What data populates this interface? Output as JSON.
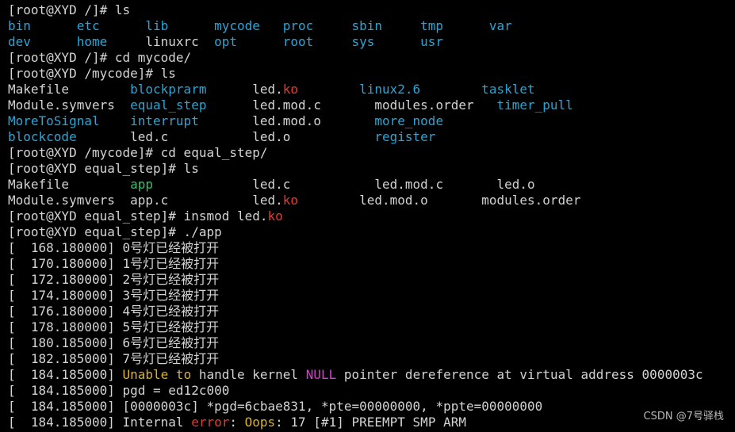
{
  "terminal": {
    "colors": {
      "background": "#000000",
      "text": "#d4d4d4",
      "blue": "#2aa5d5",
      "red": "#e33b2e",
      "green": "#2ec66a",
      "yellow": "#d9b230",
      "magenta": "#e13ad6"
    },
    "lines": [
      [
        {
          "t": "[root@XYD /]# ls",
          "c": "white"
        }
      ],
      [
        {
          "t": "bin",
          "c": "blue",
          "w": 9
        },
        {
          "t": "etc",
          "c": "blue",
          "w": 9
        },
        {
          "t": "lib",
          "c": "blue",
          "w": 9
        },
        {
          "t": "mycode",
          "c": "blue",
          "w": 9
        },
        {
          "t": "proc",
          "c": "blue",
          "w": 9
        },
        {
          "t": "sbin",
          "c": "blue",
          "w": 9
        },
        {
          "t": "tmp",
          "c": "blue",
          "w": 9
        },
        {
          "t": "var",
          "c": "blue"
        }
      ],
      [
        {
          "t": "dev",
          "c": "blue",
          "w": 9
        },
        {
          "t": "home",
          "c": "blue",
          "w": 9
        },
        {
          "t": "linuxrc",
          "c": "white",
          "w": 9
        },
        {
          "t": "opt",
          "c": "blue",
          "w": 9
        },
        {
          "t": "root",
          "c": "blue",
          "w": 9
        },
        {
          "t": "sys",
          "c": "blue",
          "w": 9
        },
        {
          "t": "usr",
          "c": "blue"
        }
      ],
      [
        {
          "t": "[root@XYD /]# cd mycode/",
          "c": "white"
        }
      ],
      [
        {
          "t": "[root@XYD /mycode]# ls",
          "c": "white"
        }
      ],
      [
        {
          "t": "Makefile",
          "c": "white",
          "w": 16
        },
        {
          "t": "blockprarm",
          "c": "blue",
          "w": 16
        },
        {
          "t": "led.",
          "c": "white"
        },
        {
          "t": "ko",
          "c": "red",
          "w": 10
        },
        {
          "t": "linux2.6",
          "c": "blue",
          "w": 16
        },
        {
          "t": "tasklet",
          "c": "blue"
        }
      ],
      [
        {
          "t": "Module.symvers",
          "c": "white",
          "w": 16
        },
        {
          "t": "equal_step",
          "c": "blue",
          "w": 16
        },
        {
          "t": "led.mod.c",
          "c": "white",
          "w": 16
        },
        {
          "t": "modules.order",
          "c": "white",
          "w": 16
        },
        {
          "t": "timer_pull",
          "c": "blue"
        }
      ],
      [
        {
          "t": "MoreToSignal",
          "c": "blue",
          "w": 16
        },
        {
          "t": "interrupt",
          "c": "blue",
          "w": 16
        },
        {
          "t": "led.mod.o",
          "c": "white",
          "w": 16
        },
        {
          "t": "more_node",
          "c": "blue"
        }
      ],
      [
        {
          "t": "blockcode",
          "c": "blue",
          "w": 16
        },
        {
          "t": "led.c",
          "c": "white",
          "w": 16
        },
        {
          "t": "led.o",
          "c": "white",
          "w": 16
        },
        {
          "t": "register",
          "c": "blue"
        }
      ],
      [
        {
          "t": "[root@XYD /mycode]# cd equal_step/",
          "c": "white"
        }
      ],
      [
        {
          "t": "[root@XYD equal_step]# ls",
          "c": "white"
        }
      ],
      [
        {
          "t": "Makefile",
          "c": "white",
          "w": 16
        },
        {
          "t": "app",
          "c": "green",
          "w": 16
        },
        {
          "t": "led.c",
          "c": "white",
          "w": 16
        },
        {
          "t": "led.mod.c",
          "c": "white",
          "w": 16
        },
        {
          "t": "led.o",
          "c": "white"
        }
      ],
      [
        {
          "t": "Module.symvers",
          "c": "white",
          "w": 16
        },
        {
          "t": "app.c",
          "c": "white",
          "w": 16
        },
        {
          "t": "led.",
          "c": "white"
        },
        {
          "t": "ko",
          "c": "red",
          "w": 10
        },
        {
          "t": "led.mod.o",
          "c": "white",
          "w": 16
        },
        {
          "t": "modules.order",
          "c": "white"
        }
      ],
      [
        {
          "t": "[root@XYD equal_step]# insmod led.",
          "c": "white"
        },
        {
          "t": "ko",
          "c": "red"
        }
      ],
      [
        {
          "t": "[root@XYD equal_step]# ./app",
          "c": "white"
        }
      ],
      [
        {
          "t": "[  168.180000] 0号灯已经被打开",
          "c": "white"
        }
      ],
      [
        {
          "t": "[  170.180000] 1号灯已经被打开",
          "c": "white"
        }
      ],
      [
        {
          "t": "[  172.180000] 2号灯已经被打开",
          "c": "white"
        }
      ],
      [
        {
          "t": "[  174.180000] 3号灯已经被打开",
          "c": "white"
        }
      ],
      [
        {
          "t": "[  176.180000] 4号灯已经被打开",
          "c": "white"
        }
      ],
      [
        {
          "t": "[  178.180000] 5号灯已经被打开",
          "c": "white"
        }
      ],
      [
        {
          "t": "[  180.185000] 6号灯已经被打开",
          "c": "white"
        }
      ],
      [
        {
          "t": "[  182.185000] 7号灯已经被打开",
          "c": "white"
        }
      ],
      [
        {
          "t": "[  184.185000] ",
          "c": "white"
        },
        {
          "t": "Unable to",
          "c": "yellow"
        },
        {
          "t": " handle kernel ",
          "c": "white"
        },
        {
          "t": "NULL",
          "c": "magenta"
        },
        {
          "t": " pointer dereference at virtual address 0000003c",
          "c": "white"
        }
      ],
      [
        {
          "t": "[  184.185000] pgd = ed12c000",
          "c": "white"
        }
      ],
      [
        {
          "t": "[  184.185000] [0000003c] *pgd=6cbae831, *pte=00000000, *ppte=00000000",
          "c": "white"
        }
      ],
      [
        {
          "t": "[  184.185000] Internal ",
          "c": "white"
        },
        {
          "t": "error",
          "c": "red"
        },
        {
          "t": ": ",
          "c": "white"
        },
        {
          "t": "Oops",
          "c": "yellow"
        },
        {
          "t": ": 17 [#1] PREEMPT SMP ARM",
          "c": "white"
        }
      ]
    ]
  },
  "watermark": "CSDN @7号驿栈"
}
